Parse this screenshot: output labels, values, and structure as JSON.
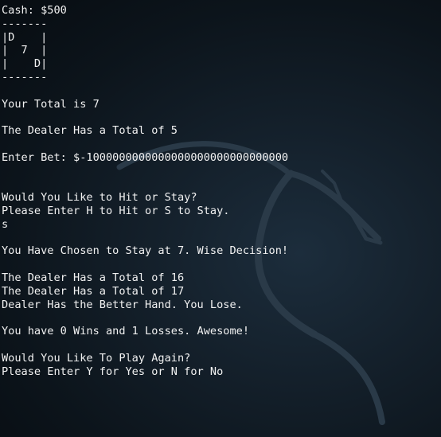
{
  "terminal": {
    "lines": [
      "Cash: $500",
      "-------",
      "|D    |",
      "|  7  |",
      "|    D|",
      "-------",
      "",
      "Your Total is 7",
      "",
      "The Dealer Has a Total of 5",
      "",
      "Enter Bet: $-1000000000000000000000000000000",
      "",
      "",
      "Would You Like to Hit or Stay?",
      "Please Enter H to Hit or S to Stay.",
      "s",
      "",
      "You Have Chosen to Stay at 7. Wise Decision!",
      "",
      "The Dealer Has a Total of 16",
      "The Dealer Has a Total of 17",
      "Dealer Has the Better Hand. You Lose.",
      "",
      "You have 0 Wins and 1 Losses. Awesome!",
      "",
      "Would You Like To Play Again?",
      "Please Enter Y for Yes or N for No"
    ],
    "cursor": ""
  },
  "colors": {
    "background": "#0c141b",
    "text": "#f2f2f2",
    "watermark": "#2a3a48"
  },
  "icons": {
    "background": "kali-dragon-watermark-icon"
  }
}
